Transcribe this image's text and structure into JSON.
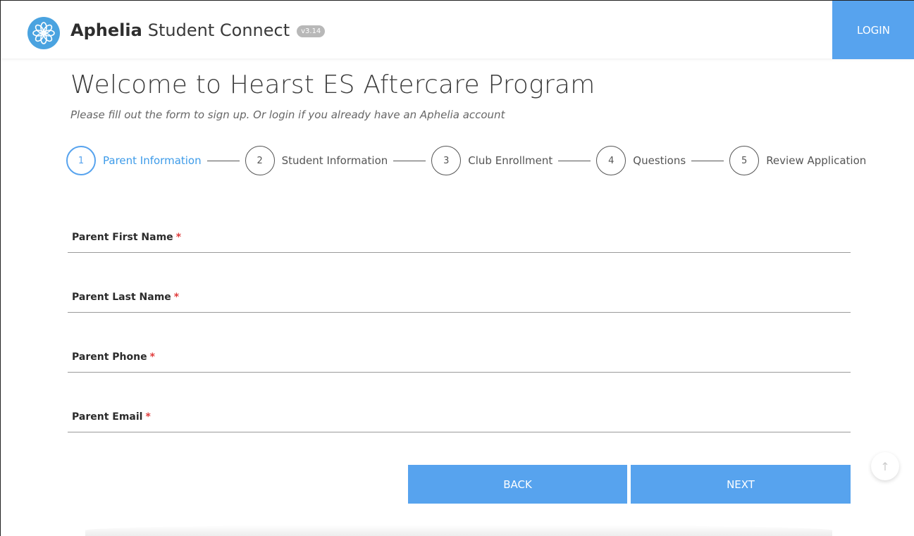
{
  "header": {
    "brand_bold": "Aphelia",
    "brand_light": "Student Connect",
    "version": "v3.14",
    "login_label": "LOGIN",
    "logo_icon": "aphelia-flower-logo",
    "accent_color": "#57a3ee"
  },
  "page": {
    "title": "Welcome to Hearst ES Aftercare Program",
    "subtitle": "Please fill out the form to sign up. Or login if you already have an Aphelia account"
  },
  "stepper": {
    "active_step": 1,
    "steps": [
      {
        "number": "1",
        "label": "Parent Information"
      },
      {
        "number": "2",
        "label": "Student Information"
      },
      {
        "number": "3",
        "label": "Club Enrollment"
      },
      {
        "number": "4",
        "label": "Questions"
      },
      {
        "number": "5",
        "label": "Review Application"
      }
    ]
  },
  "form": {
    "required_marker": "*",
    "fields": [
      {
        "label": "Parent First Name",
        "value": ""
      },
      {
        "label": "Parent Last Name",
        "value": ""
      },
      {
        "label": "Parent Phone",
        "value": ""
      },
      {
        "label": "Parent Email",
        "value": ""
      }
    ]
  },
  "actions": {
    "back_label": "BACK",
    "next_label": "NEXT",
    "scroll_top_icon": "arrow-up-icon"
  }
}
